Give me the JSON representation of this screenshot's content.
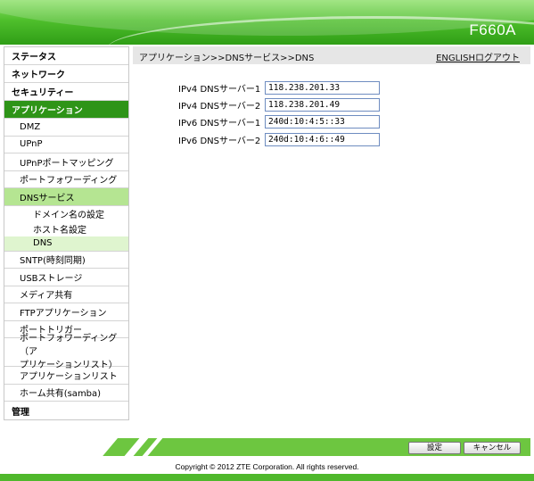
{
  "header": {
    "model": "F660A"
  },
  "sidebar": {
    "items": [
      {
        "label": "ステータス",
        "level": 1
      },
      {
        "label": "ネットワーク",
        "level": 1
      },
      {
        "label": "セキュリティー",
        "level": 1
      },
      {
        "label": "アプリケーション",
        "level": 1,
        "active": true
      },
      {
        "label": "DMZ",
        "level": 2
      },
      {
        "label": "UPnP",
        "level": 2
      },
      {
        "label": "UPnPポートマッピング",
        "level": 2
      },
      {
        "label": "ポートフォワーディング",
        "level": 2
      },
      {
        "label": "DNSサービス",
        "level": 2,
        "active": true
      },
      {
        "label": "ドメイン名の設定",
        "level": 3
      },
      {
        "label": "ホスト名設定",
        "level": 3
      },
      {
        "label": "DNS",
        "level": 3,
        "active": true
      },
      {
        "label": "SNTP(時刻同期)",
        "level": 2
      },
      {
        "label": "USBストレージ",
        "level": 2
      },
      {
        "label": "メディア共有",
        "level": 2
      },
      {
        "label": "FTPアプリケーション",
        "level": 2
      },
      {
        "label": "ポートトリガー",
        "level": 2
      },
      {
        "label": "ポートフォワーディング（アプリケーションリスト）",
        "line1": "ポートフォワーディング（ア",
        "line2": "プリケーションリスト）",
        "level": 2
      },
      {
        "label": "アプリケーションリスト",
        "level": 2
      },
      {
        "label": "ホーム共有(samba)",
        "level": 2
      },
      {
        "label": "管理",
        "level": 1
      }
    ]
  },
  "main": {
    "breadcrumb": "アプリケーション>>DNSサービス>>DNS",
    "english_logout": "ENGLISHログアウト",
    "fields": [
      {
        "label": "IPv4 DNSサーバー1",
        "value": "118.238.201.33"
      },
      {
        "label": "IPv4 DNSサーバー2",
        "value": "118.238.201.49"
      },
      {
        "label": "IPv6 DNSサーバー1",
        "value": "240d:10:4:5::33"
      },
      {
        "label": "IPv6 DNSサーバー2",
        "value": "240d:10:4:6::49"
      }
    ]
  },
  "footer": {
    "set_label": "設定",
    "cancel_label": "キャンセル",
    "copyright": "Copyright © 2012 ZTE Corporation. All rights reserved."
  },
  "colors": {
    "brand_green": "#2e9418",
    "active_sub": "#b5e592",
    "active_sub3": "#dff5cf",
    "footer_green": "#6dc640"
  }
}
